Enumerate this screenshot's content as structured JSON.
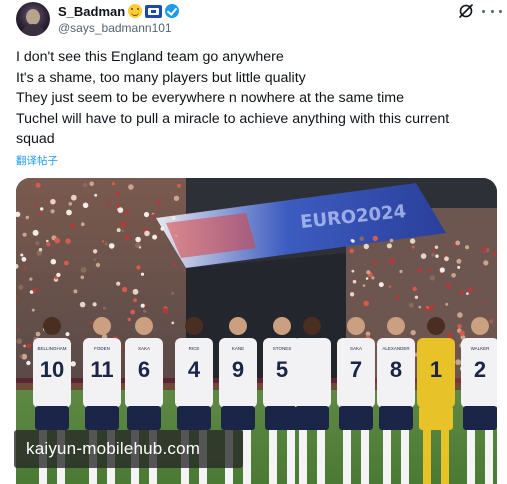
{
  "tweet": {
    "display_name": "S_Badman",
    "handle": "@says_badmann101",
    "lines": [
      "I don't see this England team go anywhere",
      "It's a shame, too many players but little quality",
      "They just seem to be everywhere n nowhere at the same time",
      "Tuchel will have to pull a miracle to achieve anything with this current",
      "squad"
    ],
    "translate_label": "翻译帖子"
  },
  "photo": {
    "players": [
      {
        "name": "BELLINGHAM",
        "number": "10"
      },
      {
        "name": "FODEN",
        "number": "11"
      },
      {
        "name": "SAKA",
        "number": "6"
      },
      {
        "name": "RICE",
        "number": "4"
      },
      {
        "name": "KANE",
        "number": "9"
      },
      {
        "name": "STONES",
        "number": "5"
      },
      {
        "name": "",
        "number": ""
      },
      {
        "name": "SAKA",
        "number": "7"
      },
      {
        "name": "ALEXANDER",
        "number": "8"
      },
      {
        "name": "",
        "number": "1"
      },
      {
        "name": "WALKER",
        "number": "2"
      }
    ]
  },
  "watermark": {
    "text": "kaiyun-mobilehub.com"
  },
  "icons": {
    "emoji": "smiling-face-icon",
    "flag": "flag-icon",
    "verified": "verified-badge-icon",
    "grok": "grok-icon",
    "more": "more-icon"
  },
  "colors": {
    "link": "#1d9bf0",
    "secondary_text": "#536471",
    "kit_white": "#f2f2f4",
    "goalkeeper_kit": "#e8c229"
  }
}
